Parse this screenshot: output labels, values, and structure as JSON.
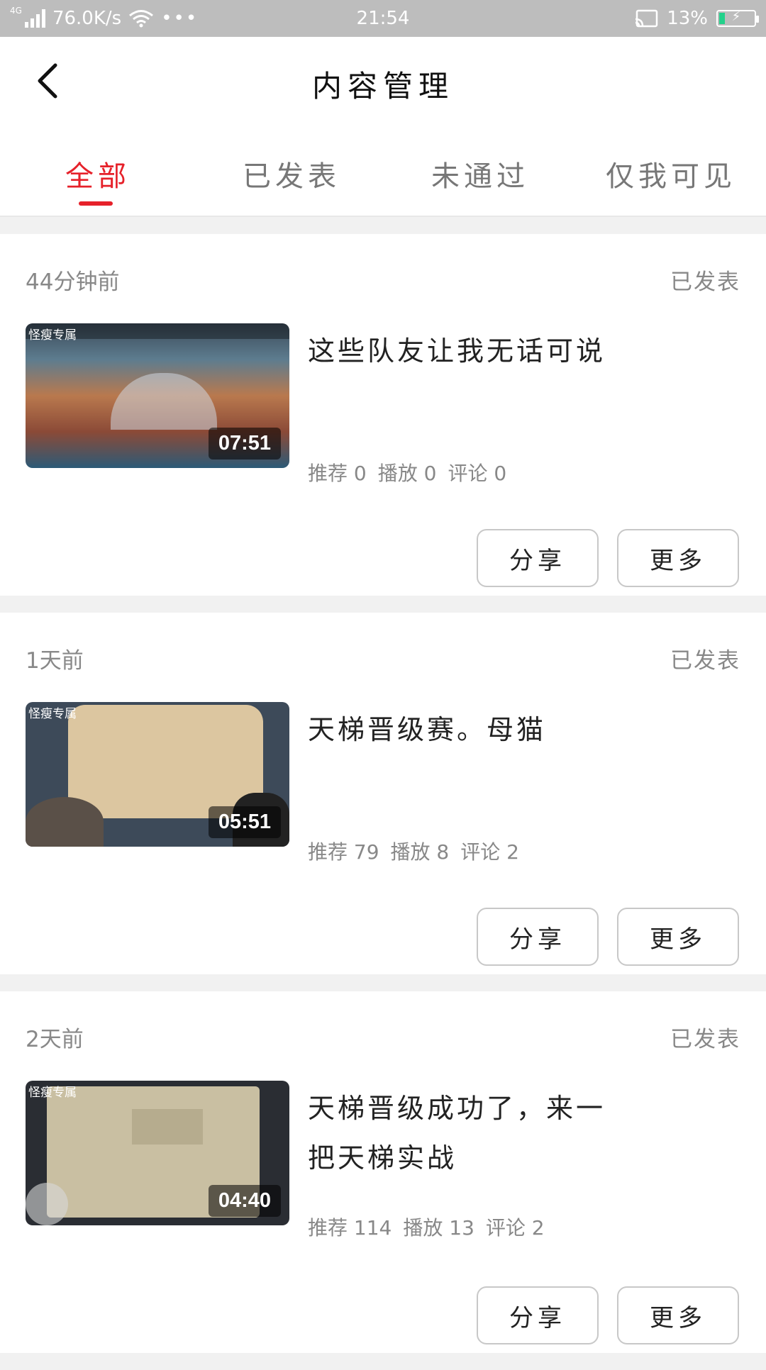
{
  "status_bar": {
    "network_type": "4G",
    "speed": "76.0K/s",
    "dots": "•••",
    "time": "21:54",
    "battery": "13%"
  },
  "header": {
    "title": "内容管理"
  },
  "tabs": [
    {
      "label": "全部",
      "active": true
    },
    {
      "label": "已发表",
      "active": false
    },
    {
      "label": "未通过",
      "active": false
    },
    {
      "label": "仅我可见",
      "active": false
    }
  ],
  "accent_color": "#e6212a",
  "items": [
    {
      "time": "44分钟前",
      "status": "已发表",
      "title": "这些队友让我无话可说",
      "duration": "07:51",
      "thumb_watermark": "怪瘦专属",
      "stats": {
        "recommend": "推荐 0",
        "play": "播放 0",
        "comment": "评论 0"
      },
      "share": "分享",
      "more": "更多"
    },
    {
      "time": "1天前",
      "status": "已发表",
      "title": "天梯晋级赛。母猫",
      "duration": "05:51",
      "thumb_watermark": "怪瘦专属",
      "stats": {
        "recommend": "推荐 79",
        "play": "播放 8",
        "comment": "评论 2"
      },
      "share": "分享",
      "more": "更多"
    },
    {
      "time": "2天前",
      "status": "已发表",
      "title": "天梯晋级成功了，来一把天梯实战",
      "duration": "04:40",
      "thumb_watermark": "怪瘦专属",
      "stats": {
        "recommend": "推荐 114",
        "play": "播放 13",
        "comment": "评论 2"
      },
      "share": "分享",
      "more": "更多"
    }
  ]
}
